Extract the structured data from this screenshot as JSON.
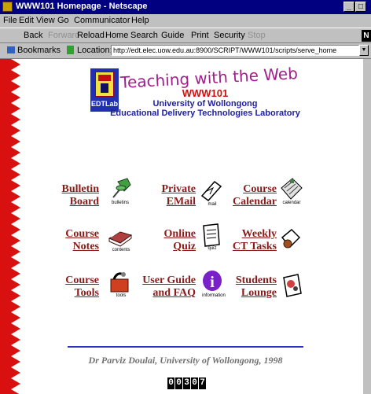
{
  "window": {
    "title": "WWW101 Homepage - Netscape"
  },
  "menu": [
    "File",
    "Edit",
    "View",
    "Go",
    "Communicator",
    "Help"
  ],
  "toolbar": {
    "back": "Back",
    "forward": "Forward",
    "reload": "Reload",
    "home": "Home",
    "search": "Search",
    "guide": "Guide",
    "print": "Print",
    "security": "Security",
    "stop": "Stop"
  },
  "location": {
    "bookmarks": "Bookmarks",
    "label": "Location:",
    "url": "http://edt.elec.uow.edu.au:8900/SCRIPT/WWW101/scripts/serve_home"
  },
  "page": {
    "logo_text": "EDTLab",
    "title": "Teaching with the Web",
    "code": "WWW101",
    "university": "University of Wollongong",
    "lab": "Educational Delivery Technologies Laboratory",
    "links": [
      {
        "l1": "Bulletin",
        "l2": "Board",
        "icon": "pushpin-icon",
        "caption": "bulletins"
      },
      {
        "l1": "Private",
        "l2": "EMail",
        "icon": "letter-icon",
        "caption": "mail"
      },
      {
        "l1": "Course",
        "l2": "Calendar",
        "icon": "calendar-icon",
        "caption": "calendar"
      },
      {
        "l1": "Course",
        "l2": "Notes",
        "icon": "book-icon",
        "caption": "contents"
      },
      {
        "l1": "Online",
        "l2": "Quiz",
        "icon": "notepad-icon",
        "caption": "quiz"
      },
      {
        "l1": "Weekly",
        "l2": "CT Tasks",
        "icon": "tasks-icon",
        "caption": ""
      },
      {
        "l1": "Course",
        "l2": "Tools",
        "icon": "toolbox-icon",
        "caption": "tools"
      },
      {
        "l1": "User Guide",
        "l2": "and FAQ",
        "icon": "info-icon",
        "caption": "information"
      },
      {
        "l1": "Students",
        "l2": "Lounge",
        "icon": "lounge-icon",
        "caption": ""
      }
    ],
    "footer": "Dr Parviz Doulai, University of Wollongong, 1998",
    "counter": [
      "0",
      "0",
      "3",
      "0",
      "7"
    ]
  },
  "colors": {
    "titlebar": "#000080",
    "link": "#8b1a1a",
    "title_magenta": "#a0208a",
    "code_red": "#d01010",
    "subtitle_blue": "#2020a0",
    "divider": "#3030c0"
  }
}
